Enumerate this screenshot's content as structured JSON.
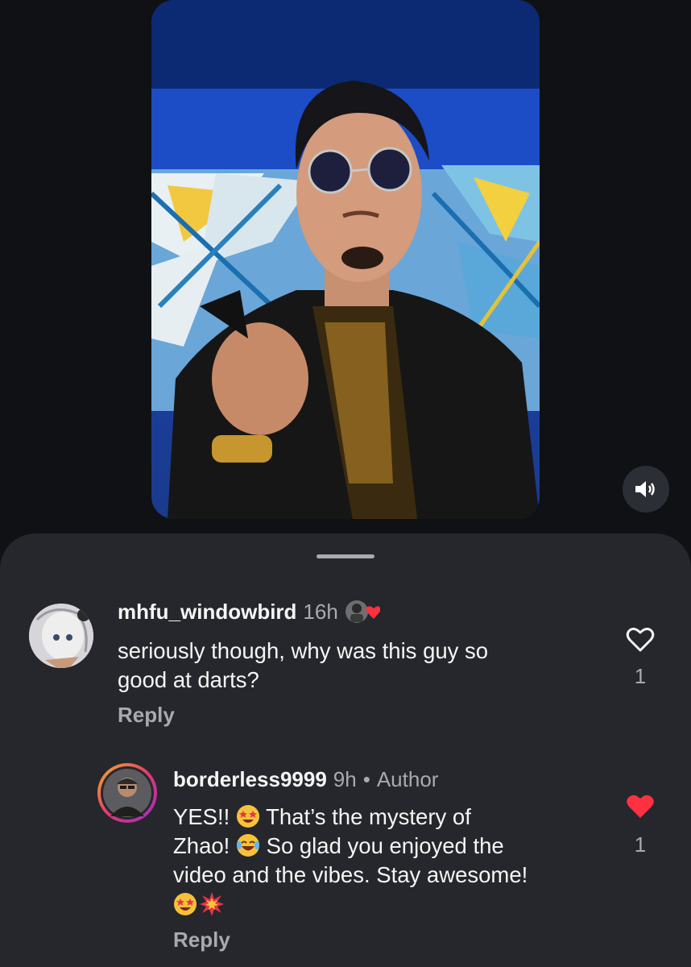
{
  "comments": [
    {
      "username": "mhfu_windowbird",
      "time": "16h",
      "text_line1": "seriously though, why was this guy so",
      "text_line2": "good at darts?",
      "reply_label": "Reply",
      "like_count": "1",
      "liked": false
    },
    {
      "username": "borderless9999",
      "time": "9h",
      "separator": "•",
      "author_tag": "Author",
      "text_line1": "YES!!",
      "text_line1b": "That’s the mystery of",
      "text_line2": "Zhao!",
      "text_line2b": "So glad you enjoyed the",
      "text_line3": "video and the vibes. Stay awesome!",
      "reply_label": "Reply",
      "like_count": "1",
      "liked": true
    }
  ],
  "colors": {
    "background": "#0f1114",
    "sheet": "#26272c",
    "like_red": "#ff3040",
    "muted_text": "#a8aab0"
  },
  "icons": {
    "mute": "speaker-icon",
    "like_empty": "heart-outline-icon",
    "like_filled": "heart-filled-icon",
    "creator_liked": "creator-heart-badge"
  }
}
